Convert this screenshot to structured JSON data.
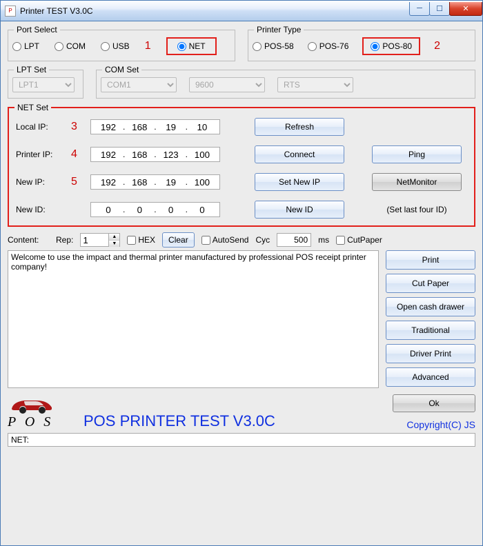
{
  "window": {
    "title": "Printer TEST V3.0C"
  },
  "portSelect": {
    "legend": "Port Select",
    "options": {
      "lpt": "LPT",
      "com": "COM",
      "usb": "USB",
      "net": "NET"
    },
    "selected": "net",
    "callout1": "1"
  },
  "printerType": {
    "legend": "Printer Type",
    "options": {
      "pos58": "POS-58",
      "pos76": "POS-76",
      "pos80": "POS-80"
    },
    "selected": "pos80",
    "callout2": "2"
  },
  "lptSet": {
    "legend": "LPT Set",
    "value": "LPT1"
  },
  "comSet": {
    "legend": "COM Set",
    "port": "COM1",
    "baud": "9600",
    "flow": "RTS"
  },
  "netSet": {
    "legend": "NET Set",
    "labels": {
      "localIp": "Local IP:",
      "printerIp": "Printer IP:",
      "newIp": "New IP:",
      "newId": "New ID:",
      "setLast": "(Set last four ID)"
    },
    "callouts": {
      "c3": "3",
      "c4": "4",
      "c5": "5"
    },
    "localIp": {
      "a": "192",
      "b": "168",
      "c": "19",
      "d": "10"
    },
    "printerIp": {
      "a": "192",
      "b": "168",
      "c": "123",
      "d": "100"
    },
    "newIp": {
      "a": "192",
      "b": "168",
      "c": "19",
      "d": "100"
    },
    "newId": {
      "a": "0",
      "b": "0",
      "c": "0",
      "d": "0"
    },
    "buttons": {
      "refresh": "Refresh",
      "connect": "Connect",
      "ping": "Ping",
      "setNewIp": "Set New IP",
      "netMonitor": "NetMonitor",
      "newId": "New ID"
    }
  },
  "content": {
    "label": "Content:",
    "repLabel": "Rep:",
    "repValue": "1",
    "hex": "HEX",
    "clear": "Clear",
    "autoSend": "AutoSend",
    "cycLabel": "Cyc",
    "cycValue": "500",
    "cycUnit": "ms",
    "cutPaperChk": "CutPaper",
    "text": "Welcome to use the impact and thermal printer manufactured by professional POS receipt printer company!"
  },
  "sideButtons": {
    "print": "Print",
    "cutPaper": "Cut Paper",
    "openDrawer": "Open cash drawer",
    "traditional": "Traditional",
    "driverPrint": "Driver Print",
    "advanced": "Advanced"
  },
  "footer": {
    "posLabel": "P O S",
    "bigTitle": "POS PRINTER TEST V3.0C",
    "ok": "Ok",
    "copyright": "Copyright(C) JS"
  },
  "status": {
    "text": "NET:"
  }
}
